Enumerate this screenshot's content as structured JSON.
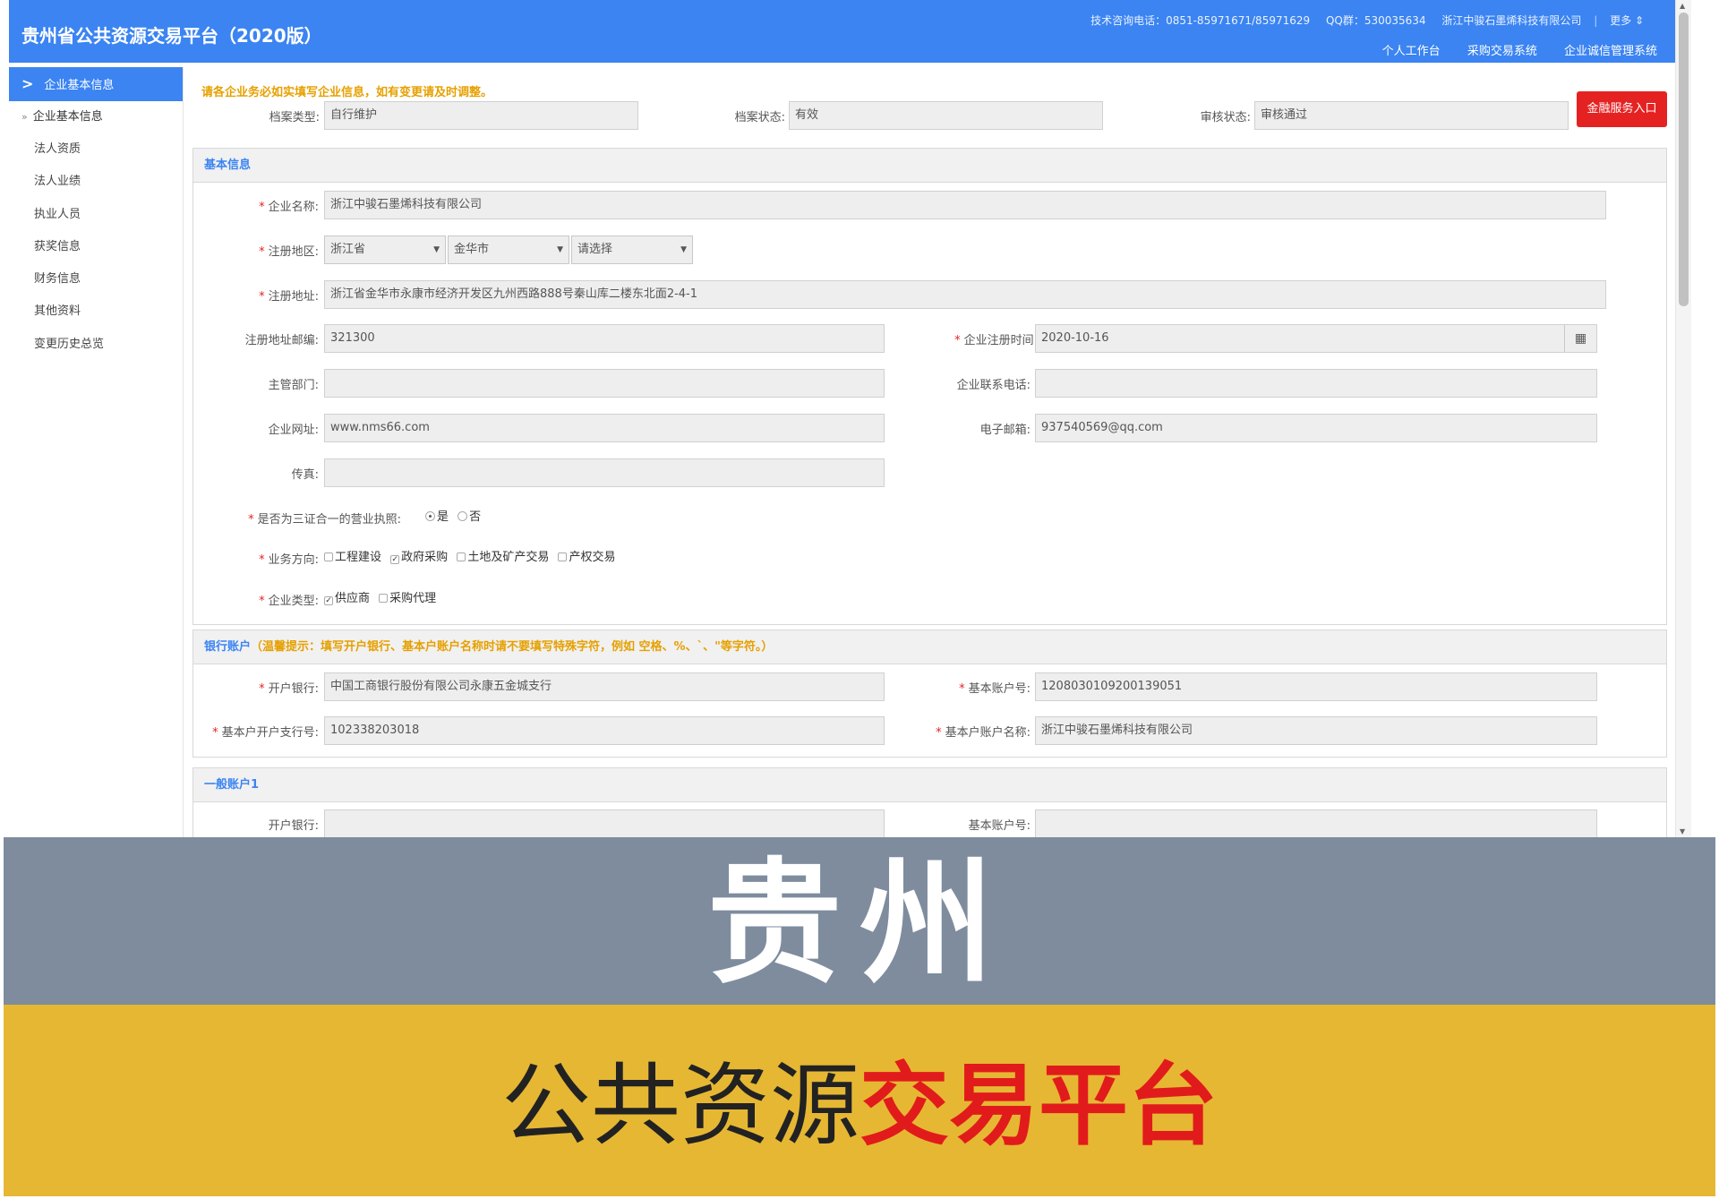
{
  "header": {
    "title": "贵州省公共资源交易平台（2020版）",
    "support_phone": "技术咨询电话：0851-85971671/85971629",
    "qq": "QQ群：530035634",
    "company": "浙江中骏石墨烯科技有限公司",
    "separator": "|",
    "more": "更多 ⇕",
    "nav": [
      "个人工作台",
      "采购交易系统",
      "企业诚信管理系统"
    ]
  },
  "sidebar": {
    "header": "企业基本信息",
    "current": "企业基本信息",
    "items": [
      "法人资质",
      "法人业绩",
      "执业人员",
      "获奖信息",
      "财务信息",
      "其他资料",
      "变更历史总览"
    ]
  },
  "form": {
    "notice": "请各企业务必如实填写企业信息，如有变更请及时调整。",
    "archive_type_label": "档案类型:",
    "archive_type": "自行维护",
    "archive_status_label": "档案状态:",
    "archive_status": "有效",
    "review_status_label": "审核状态:",
    "review_status": "审核通过",
    "finance_button": "金融服务入口",
    "required_mark": "*",
    "basic": {
      "title": "基本信息",
      "name_label": "企业名称:",
      "name": "浙江中骏石墨烯科技有限公司",
      "region_label": "注册地区:",
      "province": "浙江省",
      "city": "金华市",
      "district": "请选择",
      "address_label": "注册地址:",
      "address": "浙江省金华市永康市经济开发区九州西路888号秦山库二楼东北面2-4-1",
      "postcode_label": "注册地址邮编:",
      "postcode": "321300",
      "reg_date_label": "企业注册时间:",
      "reg_date": "2020-10-16",
      "calendar_icon": "▦",
      "dept_label": "主管部门:",
      "dept": "",
      "phone_label": "企业联系电话:",
      "phone": "",
      "website_label": "企业网址:",
      "website": "www.nms66.com",
      "email_label": "电子邮箱:",
      "email": "937540569@qq.com",
      "fax_label": "传真:",
      "fax": "",
      "license_label": "是否为三证合一的营业执照:",
      "license_yes": "是",
      "license_no": "否",
      "business_label": "业务方向:",
      "business_options": [
        "工程建设",
        "政府采购",
        "土地及矿产交易",
        "产权交易"
      ],
      "type_label": "企业类型:",
      "type_options": [
        "供应商",
        "采购代理"
      ],
      "check_mark": "✓"
    },
    "bank": {
      "title": "银行账户",
      "tip": "（温馨提示：填写开户银行、基本户账户名称时请不要填写特殊字符，例如 空格、%、`、\"等字符。）",
      "bank_label": "开户银行:",
      "bank": "中国工商银行股份有限公司永康五金城支行",
      "account_label": "基本账户号:",
      "account": "1208030109200139051",
      "branch_no_label": "基本户开户支行号:",
      "branch_no": "102338203018",
      "account_name_label": "基本户账户名称:",
      "account_name": "浙江中骏石墨烯科技有限公司"
    },
    "general": {
      "title": "一般账户1",
      "bank_label": "开户银行:",
      "account_label": "基本账户号:"
    }
  },
  "banner": {
    "big": "贵州",
    "sub_normal": "公共资源",
    "sub_red": "交易平台"
  },
  "colors": {
    "primary": "#3b84f2",
    "red": "#e52222",
    "notice": "#e6a000",
    "banner_gray": "#7e8c9e",
    "banner_yellow": "#e6b733"
  }
}
